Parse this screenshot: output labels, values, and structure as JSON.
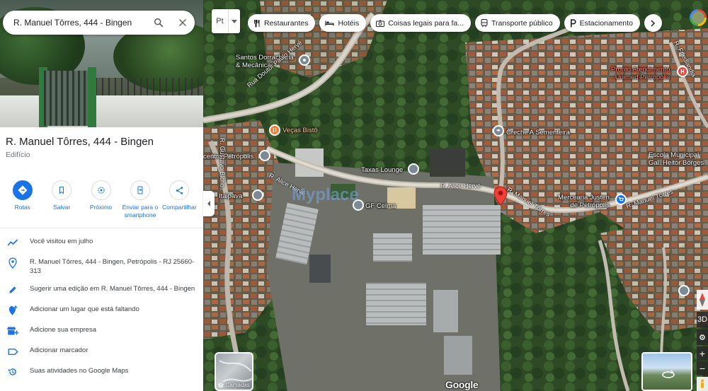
{
  "search": {
    "query": "R. Manuel Tôrres, 444 - Bingen"
  },
  "place": {
    "title": "R. Manuel Tôrres, 444 - Bingen",
    "category": "Edifício"
  },
  "actions": [
    {
      "label": "Rotas",
      "icon": "directions-icon"
    },
    {
      "label": "Salvar",
      "icon": "bookmark-icon"
    },
    {
      "label": "Próximo",
      "icon": "nearby-icon"
    },
    {
      "label": "Enviar para o smartphone",
      "icon": "send-to-phone-icon"
    },
    {
      "label": "Compartilhar",
      "icon": "share-icon"
    }
  ],
  "details": [
    {
      "icon": "timeline-icon",
      "text": "Você visitou em julho"
    },
    {
      "icon": "location-pin-icon",
      "text": "R. Manuel Tôrres, 444 - Bingen, Petrópolis - RJ 25660-313"
    },
    {
      "icon": "edit-pencil-icon",
      "text": "Sugerir uma edição em R. Manuel Tôrres, 444 - Bingen"
    },
    {
      "icon": "add-place-icon",
      "text": "Adicionar um lugar que está faltando"
    },
    {
      "icon": "add-business-icon",
      "text": "Adicione sua empresa"
    },
    {
      "icon": "label-icon",
      "text": "Adicionar marcador"
    },
    {
      "icon": "history-icon",
      "text": "Suas atividades no Google Maps"
    }
  ],
  "map": {
    "language_value": "Pt",
    "chips": [
      {
        "label": "Restaurantes",
        "icon": "fork-knife-icon"
      },
      {
        "label": "Hotéis",
        "icon": "bed-icon"
      },
      {
        "label": "Coisas legais para fa...",
        "icon": "camera-icon"
      },
      {
        "label": "Transporte público",
        "icon": "train-icon"
      },
      {
        "label": "Estacionamento",
        "icon": "parking-icon"
      }
    ],
    "place_labels": {
      "santos": "Santos Dorracharia\n& Mecânica",
      "pronto": "Pronto Atendimento\n- Unimed Petrópolis",
      "vecas": "Veças Bistô",
      "creche": "Creche A Sementeira",
      "escola": "Escola Municipal\nGal. Heitor Borges",
      "centro": "centro Petrópolis",
      "taxas": "Taxas Lounge",
      "itaipava": "Itaipava",
      "gf": "GF Celma",
      "mercearia": "Mercearia Justen\nde Petrópolis"
    },
    "road_labels": {
      "doutor_paulo": "Rua Doutor Paulo Hervé",
      "gustavo": "R. Gustavo Bicho",
      "alice1": "R. Alice Hervé",
      "alice2": "R. Alice Hervé",
      "manuel1": "R. Manuel Tôrres",
      "manuel2": "R. Manuel Tôrres",
      "friedland": "R. Friedlandia"
    },
    "layers_label": "Camadas",
    "logo": "Google",
    "watermark": "Myplace",
    "controls": {
      "three_d": "3D",
      "zoom_in": "+",
      "zoom_out": "−"
    },
    "colors": {
      "accent": "#1a73e8",
      "pin": "#ea4335"
    }
  }
}
